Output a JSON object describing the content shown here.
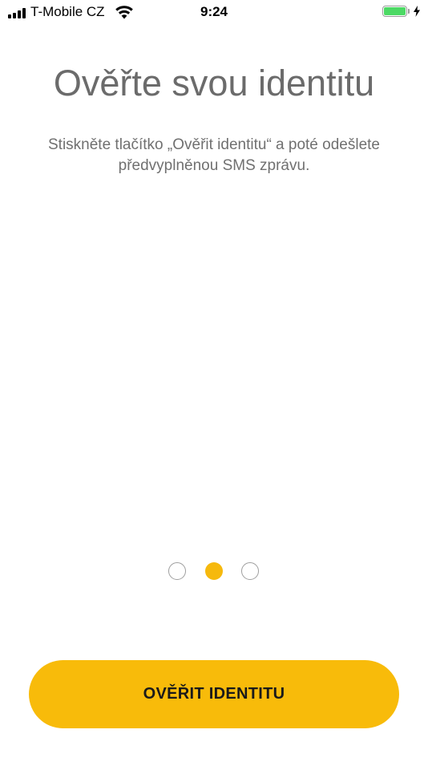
{
  "status_bar": {
    "carrier": "T-Mobile CZ",
    "time": "9:24",
    "signal_icon": "signal-bars-icon",
    "wifi_icon": "wifi-icon",
    "battery_icon": "battery-icon",
    "charging_icon": "charging-bolt-icon",
    "battery_color": "#4cd964"
  },
  "onboarding": {
    "title": "Ověřte svou identitu",
    "subtitle": "Stiskněte tlačítko „Ověřit identitu“ a poté odešlete předvyplněnou SMS zprávu.",
    "page_indicator": {
      "total_pages": 3,
      "current_page": 2
    },
    "primary_button_label": "OVĚŘIT IDENTITU"
  },
  "colors": {
    "accent": "#f8bb0a",
    "title_text": "#6b6b6b",
    "body_text": "#707070",
    "inactive_dot_border": "#9e9e9e"
  }
}
